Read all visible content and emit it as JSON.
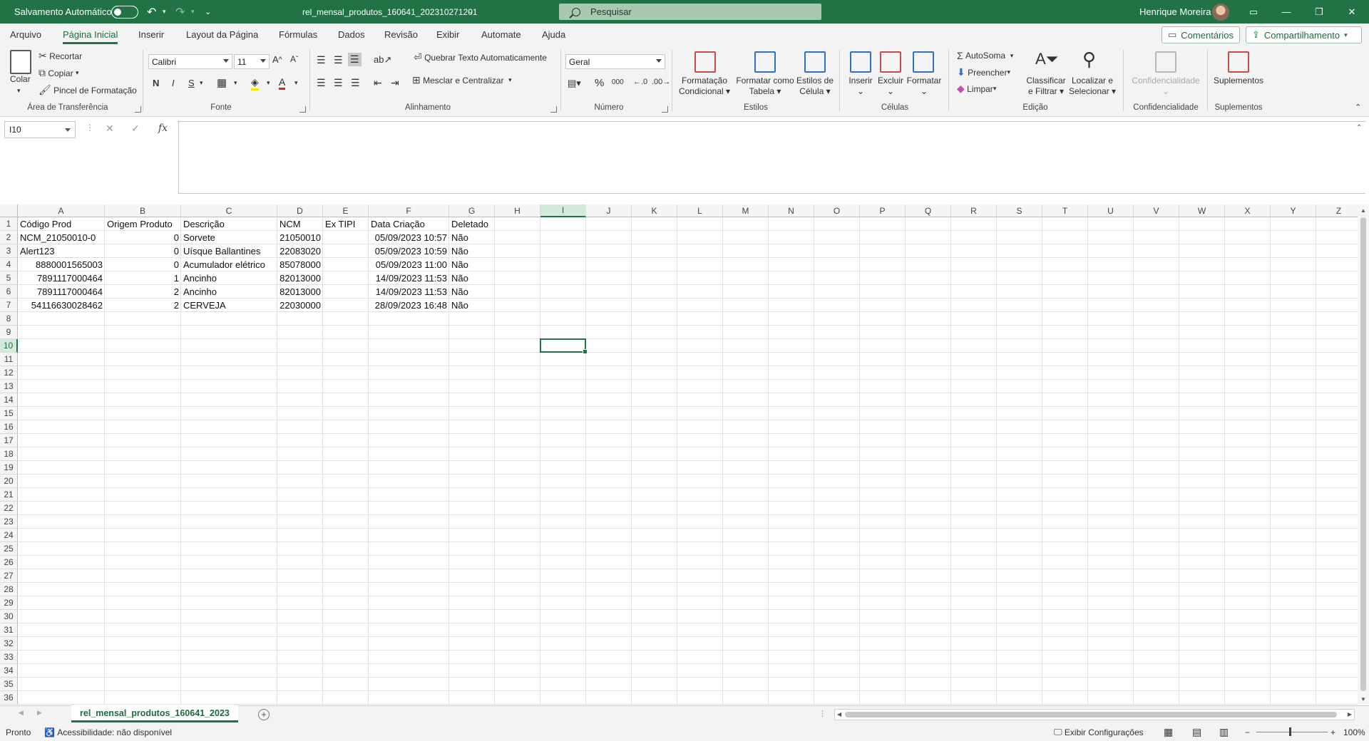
{
  "titlebar": {
    "autosave_label": "Salvamento Automático",
    "filename": "rel_mensal_produtos_160641_202310271201",
    "search_placeholder": "Pesquisar",
    "user_name": "Henrique Moreira"
  },
  "menu": {
    "tabs": [
      "Arquivo",
      "Página Inicial",
      "Inserir",
      "Layout da Página",
      "Fórmulas",
      "Dados",
      "Revisão",
      "Exibir",
      "Automate",
      "Ajuda"
    ],
    "active": "Página Inicial",
    "comments_label": "Comentários",
    "share_label": "Compartilhamento"
  },
  "ribbon": {
    "clipboard": {
      "paste": "Colar",
      "cut": "Recortar",
      "copy": "Copiar",
      "format_painter": "Pincel de Formatação",
      "label": "Área de Transferência"
    },
    "font": {
      "name": "Calibri",
      "size": "11",
      "bold": "N",
      "italic": "I",
      "underline": "S",
      "label": "Fonte"
    },
    "alignment": {
      "wrap": "Quebrar Texto Automaticamente",
      "merge": "Mesclar e Centralizar",
      "label": "Alinhamento"
    },
    "number": {
      "format": "Geral",
      "label": "Número"
    },
    "styles": {
      "conditional": [
        "Formatação",
        "Condicional"
      ],
      "as_table": [
        "Formatar como",
        "Tabela"
      ],
      "cell_styles": [
        "Estilos de",
        "Célula"
      ],
      "label": "Estilos"
    },
    "cells": {
      "insert": "Inserir",
      "delete": "Excluir",
      "format": "Formatar",
      "label": "Células"
    },
    "editing": {
      "autosum": "AutoSoma",
      "fill": "Preencher",
      "clear": "Limpar",
      "sort": [
        "Classificar",
        "e Filtrar"
      ],
      "find": [
        "Localizar e",
        "Selecionar"
      ],
      "label": "Edição"
    },
    "sensitivity": {
      "button": "Confidencialidade",
      "label": "Confidencialidade"
    },
    "addins": {
      "button": "Suplementos",
      "label": "Suplementos"
    }
  },
  "formula": {
    "namebox": "I10",
    "content": ""
  },
  "grid": {
    "columns": [
      "A",
      "B",
      "C",
      "D",
      "E",
      "F",
      "G",
      "H",
      "I",
      "J",
      "K",
      "L",
      "M",
      "N",
      "O",
      "P",
      "Q",
      "R",
      "S",
      "T",
      "U",
      "V",
      "W",
      "X",
      "Y",
      "Z"
    ],
    "selected_col": "I",
    "selected_row": 10,
    "rows_visible": 36,
    "cells": [
      [
        "Código Prod",
        "Origem Produto",
        "Descrição",
        "NCM",
        "Ex TIPI",
        "Data Criação",
        "Deletado"
      ],
      [
        "NCM_21050010-0",
        "0",
        "Sorvete",
        "21050010",
        "",
        "05/09/2023 10:57",
        "Não"
      ],
      [
        "Alert123",
        "0",
        "Uísque Ballantines",
        "22083020",
        "",
        "05/09/2023 10:59",
        "Não"
      ],
      [
        "8880001565003",
        "0",
        "Acumulador elétrico",
        "85078000",
        "",
        "05/09/2023 11:00",
        "Não"
      ],
      [
        "7891117000464",
        "1",
        "Ancinho",
        "82013000",
        "",
        "14/09/2023 11:53",
        "Não"
      ],
      [
        "7891117000464",
        "2",
        "Ancinho",
        "82013000",
        "",
        "14/09/2023 11:53",
        "Não"
      ],
      [
        "54116630028462",
        "2",
        "CERVEJA",
        "22030000",
        "",
        "28/09/2023 16:48",
        "Não"
      ]
    ]
  },
  "sheets": {
    "active": "rel_mensal_produtos_160641_2023"
  },
  "status": {
    "ready": "Pronto",
    "accessibility": "Acessibilidade: não disponível",
    "display_settings": "Exibir Configurações",
    "zoom": "100%"
  }
}
